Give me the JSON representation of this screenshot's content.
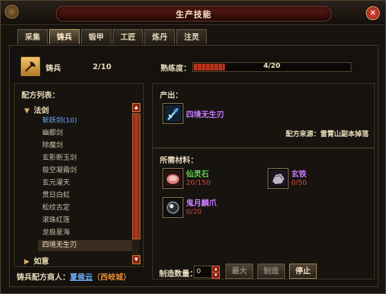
{
  "window": {
    "title": "生产技能"
  },
  "tabs": [
    {
      "label": "采集",
      "active": false
    },
    {
      "label": "铸兵",
      "active": true
    },
    {
      "label": "锻甲",
      "active": false
    },
    {
      "label": "工匠",
      "active": false
    },
    {
      "label": "炼丹",
      "active": false
    },
    {
      "label": "注灵",
      "active": false
    }
  ],
  "skill": {
    "icon": "axe-icon",
    "name": "铸兵",
    "level": "2/10",
    "proficiency_label": "熟练度：",
    "proficiency_text": "4/20",
    "proficiency_value": 4,
    "proficiency_max": 20
  },
  "recipe_list": {
    "header": "配方列表：",
    "category1": "法剑",
    "items": [
      "斩妖剑(10)",
      "幽都剑",
      "除魔剑",
      "玄影断玉剑",
      "极空凝霜剑",
      "玄元濯天",
      "贯日白虹",
      "松纹古定",
      "滚珠红莲",
      "龙极星海",
      "四境无生刃"
    ],
    "category2": "如意"
  },
  "merchant": {
    "label": "铸兵配方商人：",
    "name": "夏侯云",
    "city": "（西岐城）"
  },
  "output": {
    "header": "产出：",
    "item_name": "四境无生刃",
    "item_icon": "blade-icon",
    "source": "配方来源：雷霄山副本掉落"
  },
  "materials": {
    "header": "所需材料：",
    "list": [
      {
        "name": "仙灵石",
        "count": "20/150",
        "color": "#62d44f",
        "icon": "spirit-stone-icon"
      },
      {
        "name": "玄铁",
        "count": "0/50",
        "color": "#c77dff",
        "icon": "iron-ore-icon"
      },
      {
        "name": "鬼月麟爪",
        "count": "0/20",
        "color": "#c77dff",
        "icon": "claw-orb-icon"
      }
    ]
  },
  "craft": {
    "qty_label": "制造数量：",
    "qty_value": "0",
    "btn_max": "最大",
    "btn_make": "制造",
    "btn_stop": "停止"
  },
  "colors": {
    "accent_red": "#b5331e",
    "link_blue": "#6fb3ff",
    "purple": "#c77dff",
    "green": "#62d44f"
  }
}
